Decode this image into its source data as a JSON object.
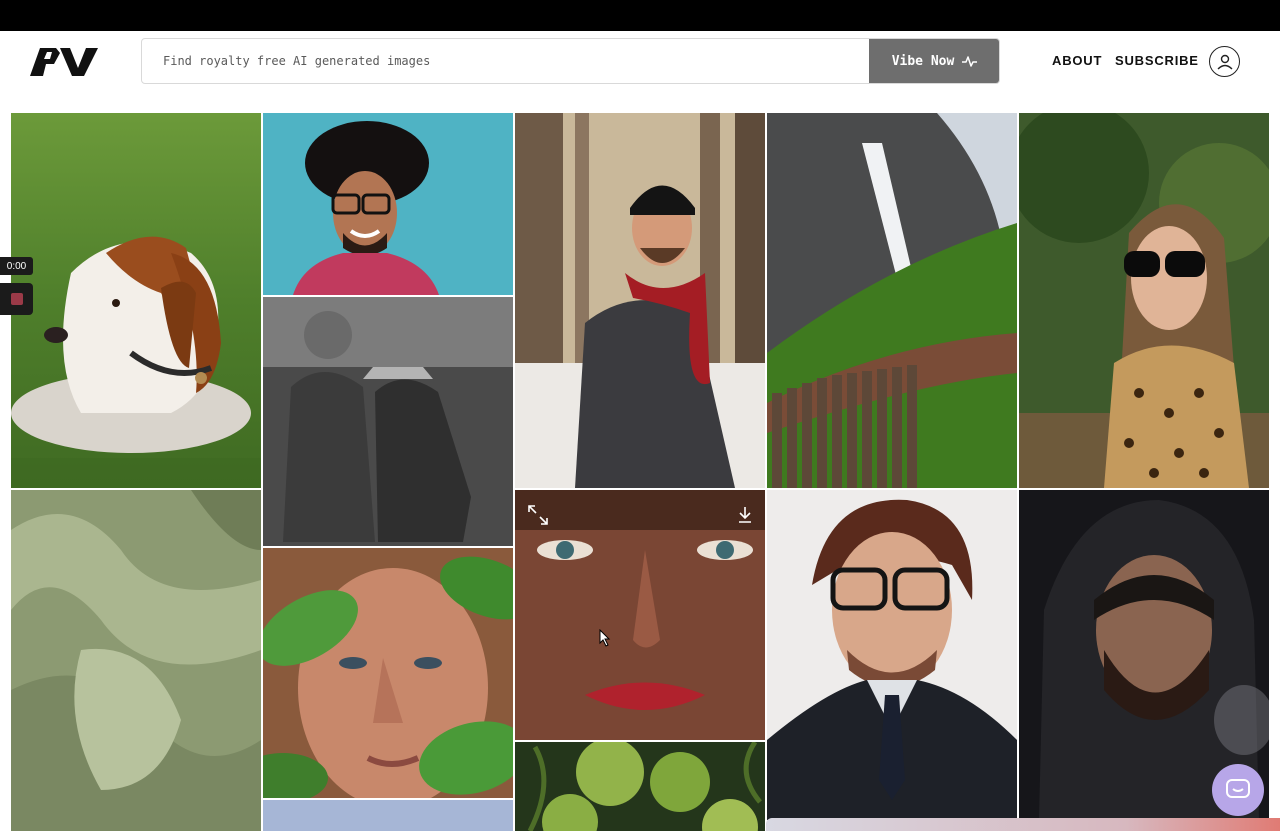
{
  "app": {
    "brand_icon": "pv-logo"
  },
  "search": {
    "placeholder": "Find royalty free AI generated images",
    "value": ""
  },
  "vibe_button": {
    "label": "Vibe Now",
    "icon": "activity-pulse-icon"
  },
  "nav": {
    "about": "ABOUT",
    "subscribe": "SUBSCRIBE",
    "account_icon": "user-circle-icon"
  },
  "recorder": {
    "time": "0:00"
  },
  "gallery": {
    "tiles": [
      {
        "subject": "dog"
      },
      {
        "subject": "man with afro"
      },
      {
        "subject": "man in beanie"
      },
      {
        "subject": "waterfall"
      },
      {
        "subject": "woman with sunglasses"
      },
      {
        "subject": "elderly couple"
      },
      {
        "subject": "green silk"
      },
      {
        "subject": "freckled face"
      },
      {
        "subject": "man with glasses"
      },
      {
        "subject": "hooded man"
      },
      {
        "subject": "man with leaves"
      },
      {
        "subject": "green tomatoes"
      }
    ]
  },
  "colors": {
    "accent_button": "#6e6e6e",
    "chat_bubble": "#b7a6e8"
  }
}
